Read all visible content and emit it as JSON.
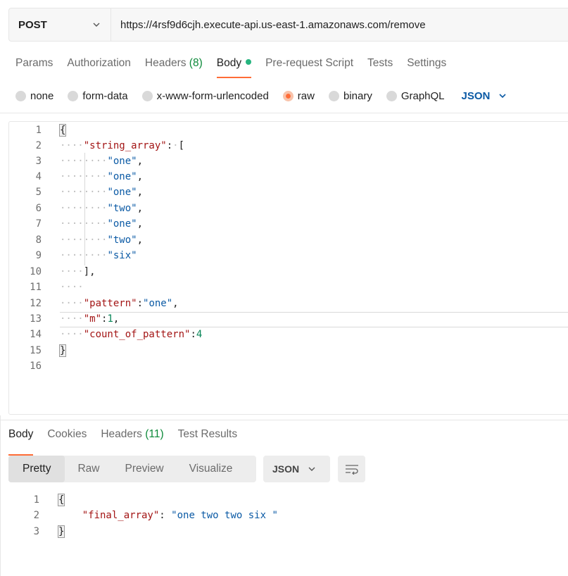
{
  "request": {
    "method": "POST",
    "url": "https://4rsf9d6cjh.execute-api.us-east-1.amazonaws.com/remove"
  },
  "request_tabs": [
    {
      "label": "Params"
    },
    {
      "label": "Authorization"
    },
    {
      "label": "Headers",
      "count": "(8)"
    },
    {
      "label": "Body"
    },
    {
      "label": "Pre-request Script"
    },
    {
      "label": "Tests"
    },
    {
      "label": "Settings"
    }
  ],
  "body_types": [
    "none",
    "form-data",
    "x-www-form-urlencoded",
    "raw",
    "binary",
    "GraphQL"
  ],
  "selected_body_type": "raw",
  "raw_language": "JSON",
  "editor": {
    "line_numbers": [
      "1",
      "2",
      "3",
      "4",
      "5",
      "6",
      "7",
      "8",
      "9",
      "10",
      "11",
      "12",
      "13",
      "14",
      "15",
      "16"
    ],
    "json_keys": {
      "string_array": "\"string_array\"",
      "pattern": "\"pattern\"",
      "m": "\"m\"",
      "count_of_pattern": "\"count_of_pattern\""
    },
    "string_array_values": [
      "\"one\"",
      "\"one\"",
      "\"one\"",
      "\"two\"",
      "\"one\"",
      "\"two\"",
      "\"six\""
    ],
    "pattern_value": "\"one\"",
    "m_value": "1",
    "count_of_pattern_value": "4"
  },
  "response_tabs": [
    {
      "label": "Body"
    },
    {
      "label": "Cookies"
    },
    {
      "label": "Headers",
      "count": "(11)"
    },
    {
      "label": "Test Results"
    }
  ],
  "response_views": [
    "Pretty",
    "Raw",
    "Preview",
    "Visualize"
  ],
  "response_format": "JSON",
  "response": {
    "line_numbers": [
      "1",
      "2",
      "3"
    ],
    "key": "\"final_array\"",
    "value": "\"one two two six \""
  },
  "colors": {
    "accent": "#ff6c37",
    "status_dot": "#26b47f",
    "json_key": "#a31515",
    "json_string": "#0b5aa5",
    "json_number": "#098658"
  },
  "icons": {
    "method_dropdown": "chevron-down-icon",
    "language_dropdown": "chevron-down-icon",
    "wrap": "text-wrap-icon"
  }
}
